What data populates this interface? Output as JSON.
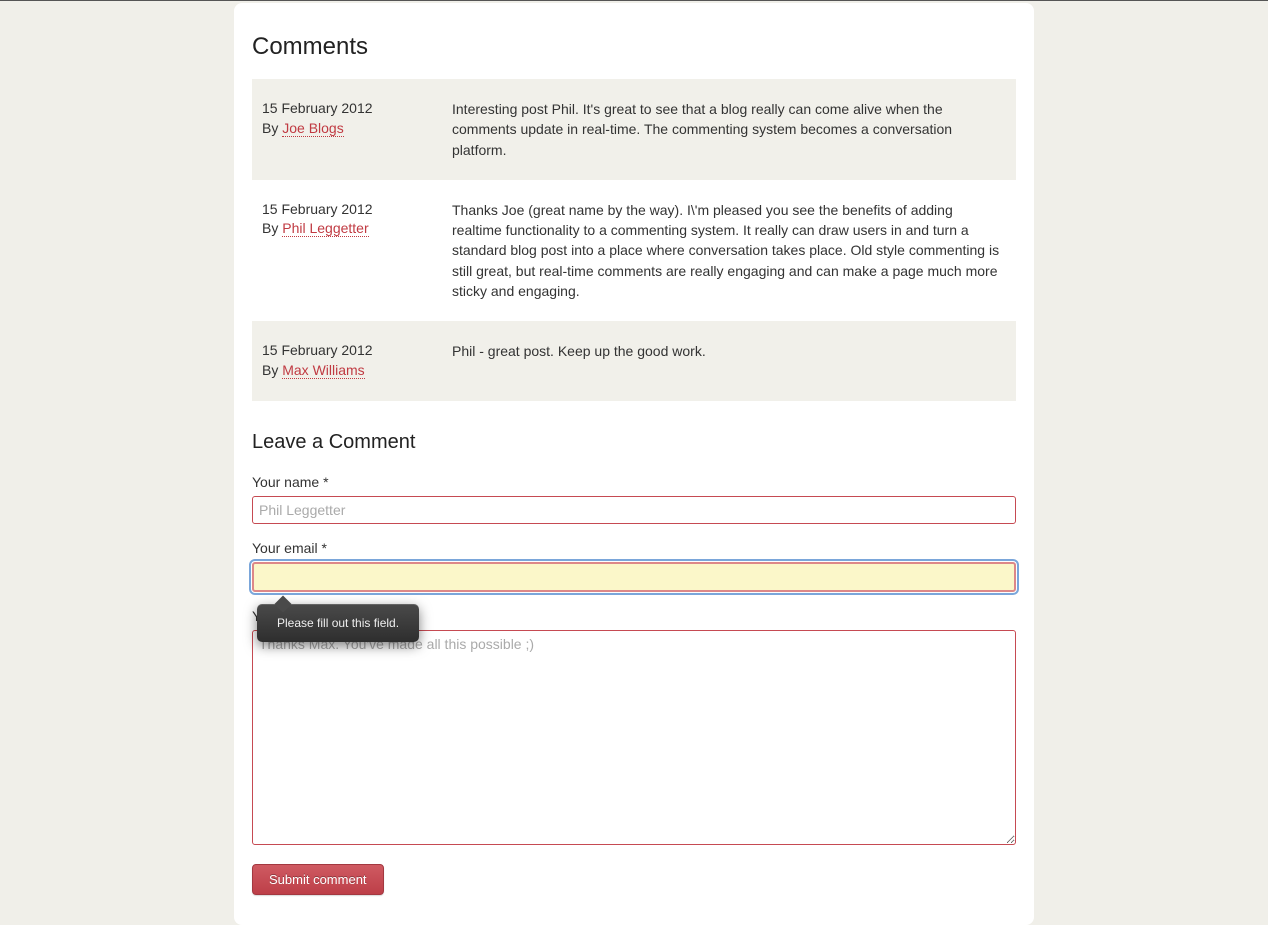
{
  "comments_heading": "Comments",
  "by_prefix": "By",
  "comments": [
    {
      "date": "15 February 2012",
      "author": "Joe Blogs",
      "body": "Interesting post Phil. It's great to see that a blog really can come alive when the comments update in real-time. The commenting system becomes a conversation platform."
    },
    {
      "date": "15 February 2012",
      "author": "Phil Leggetter",
      "body": "Thanks Joe (great name by the way). I\\'m pleased you see the benefits of adding realtime functionality to a commenting system. It really can draw users in and turn a standard blog post into a place where conversation takes place. Old style commenting is still great, but real-time comments are really engaging and can make a page much more sticky and engaging."
    },
    {
      "date": "15 February 2012",
      "author": "Max Williams",
      "body": "Phil - great post. Keep up the good work."
    }
  ],
  "leave_heading": "Leave a Comment",
  "form": {
    "name_label": "Your name *",
    "name_placeholder": "Phil Leggetter",
    "email_label": "Your email *",
    "email_value": "",
    "comment_label": "Your comment *",
    "comment_placeholder": "Thanks Max. You've made all this possible ;)",
    "submit_label": "Submit comment",
    "validation_tooltip": "Please fill out this field."
  }
}
